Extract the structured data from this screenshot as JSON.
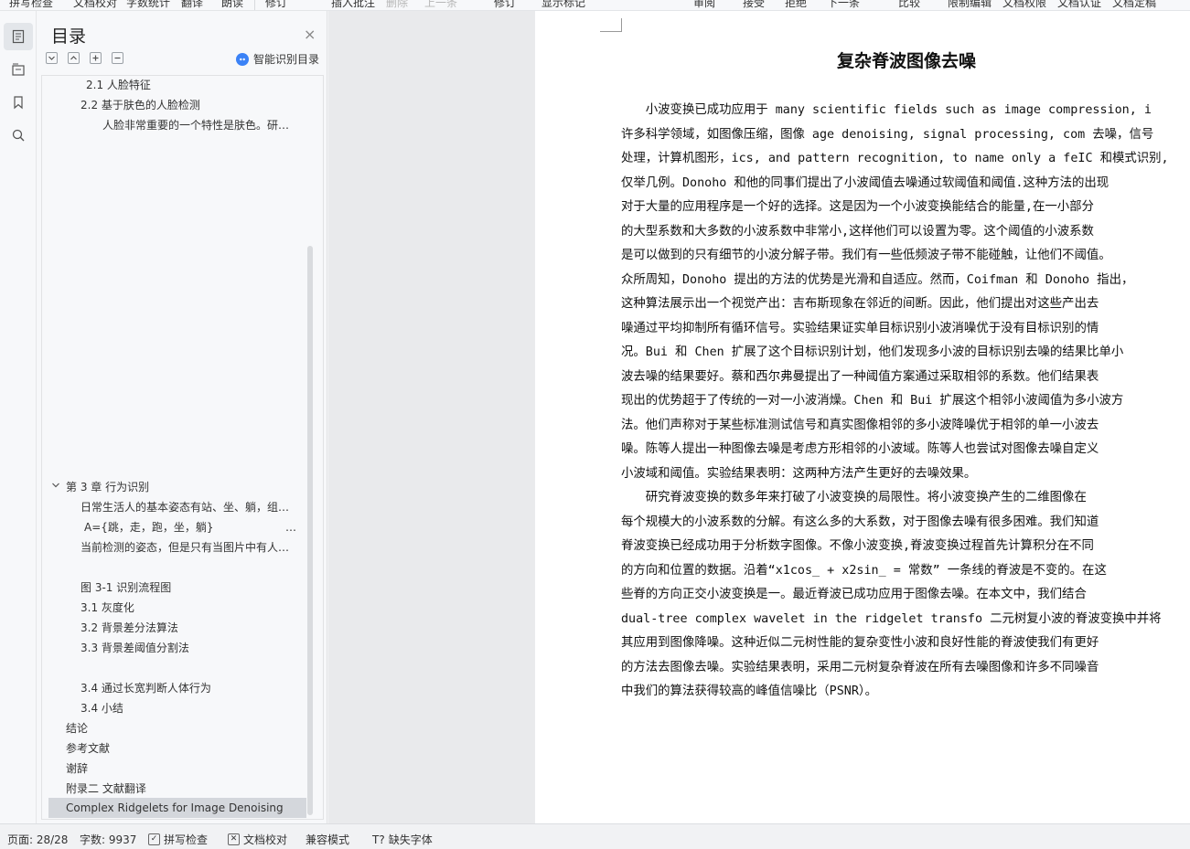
{
  "toolbar": {
    "items": [
      "拼写检查",
      "文档校对",
      "字数统计",
      "翻译",
      "朗读",
      "修订",
      "插入批注",
      "删除",
      "上一条",
      "修订",
      "显示标记",
      "审阅",
      "接受",
      "拒绝",
      "下一条",
      "比较",
      "限制编辑",
      "文档权限",
      "文档认证",
      "文档定稿"
    ]
  },
  "rail": {
    "icons": [
      "toc-icon",
      "navigation-icon",
      "bookmark-icon",
      "search-icon"
    ]
  },
  "toc": {
    "title": "目录",
    "close_glyph": "×",
    "smart_label": "智能识别目录",
    "items": [
      {
        "text": "2.1 人脸特征"
      },
      {
        "text": "2.2 基于肤色的人脸检测"
      },
      {
        "text": "人脸非常重要的一个特性是肤色。研…"
      },
      {
        "text": "第 3 章 行为识别"
      },
      {
        "text": "日常生活人的基本姿态有站、坐、躺，组…"
      },
      {
        "text": "A={跳，走，跑，坐，躺}"
      },
      {
        "text": "…"
      },
      {
        "text": "当前检测的姿态，但是只有当图片中有人…"
      },
      {
        "text": "图 3-1 识别流程图"
      },
      {
        "text": "3.1 灰度化"
      },
      {
        "text": "3.2 背景差分法算法"
      },
      {
        "text": "3.3 背景差阈值分割法"
      },
      {
        "text": "3.4 通过长宽判断人体行为"
      },
      {
        "text": "3.4 小结"
      },
      {
        "text": "结论"
      },
      {
        "text": "参考文献"
      },
      {
        "text": "谢辞"
      },
      {
        "text": "附录二 文献翻译"
      },
      {
        "text": "Complex Ridgelets for Image Denoising"
      }
    ]
  },
  "document": {
    "title": "复杂脊波图像去噪",
    "lines": [
      "　　小波变换已成功应用于 many scientific fields such as image compression, i",
      "许多科学领域，如图像压缩，图像 age denoising, signal processing, com 去噪，信号",
      "处理，计算机图形，ics, and pattern recognition, to name only a feIC 和模式识别,",
      "仅举几例。Donoho 和他的同事们提出了小波阈值去噪通过软阈值和阈值.这种方法的出现",
      "对于大量的应用程序是一个好的选择。这是因为一个小波变换能结合的能量,在一小部分",
      "的大型系数和大多数的小波系数中非常小,这样他们可以设置为零。这个阈值的小波系数",
      "是可以做到的只有细节的小波分解子带。我们有一些低频波子带不能碰触，让他们不阈值。",
      "众所周知，Donoho 提出的方法的优势是光滑和自适应。然而，Coifman 和 Donoho 指出，",
      "这种算法展示出一个视觉产出：吉布斯现象在邻近的间断。因此，他们提出对这些产出去",
      "噪通过平均抑制所有循环信号。实验结果证实单目标识别小波消噪优于没有目标识别的情",
      "况。Bui 和 Chen 扩展了这个目标识别计划，他们发现多小波的目标识别去噪的结果比单小",
      "波去噪的结果要好。蔡和西尔弗曼提出了一种阈值方案通过采取相邻的系数。他们结果表",
      "现出的优势超于了传统的一对一小波消燥。Chen 和 Bui 扩展这个相邻小波阈值为多小波方",
      "法。他们声称对于某些标准测试信号和真实图像相邻的多小波降噪优于相邻的单一小波去",
      "噪。陈等人提出一种图像去噪是考虑方形相邻的小波域。陈等人也尝试对图像去噪自定义",
      "小波域和阈值。实验结果表明：这两种方法产生更好的去噪效果。",
      "　　研究脊波变换的数多年来打破了小波变换的局限性。将小波变换产生的二维图像在",
      "每个规模大的小波系数的分解。有这么多的大系数，对于图像去噪有很多困难。我们知道",
      "脊波变换已经成功用于分析数字图像。不像小波变换,脊波变换过程首先计算积分在不同",
      "的方向和位置的数据。沿着“x1cos_ + x2sin_ = 常数” 一条线的脊波是不变的。在这",
      "些脊的方向正交小波变换是一。最近脊波已成功应用于图像去噪。在本文中，我们结合",
      "dual-tree complex wavelet in the ridgelet transfo 二元树复小波的脊波变换中并将",
      "其应用到图像降噪。这种近似二元树性能的复杂变性小波和良好性能的脊波使我们有更好",
      "的方法去图像去噪。实验结果表明，采用二元树复杂脊波在所有去噪图像和许多不同噪音",
      "中我们的算法获得较高的峰值信噪比（PSNR）。"
    ]
  },
  "status": {
    "page": "页面: 28/28",
    "words": "字数: 9937",
    "spell": "拼写检查",
    "proof": "文档校对",
    "compat": "兼容模式",
    "missing_font": "缺失字体"
  }
}
